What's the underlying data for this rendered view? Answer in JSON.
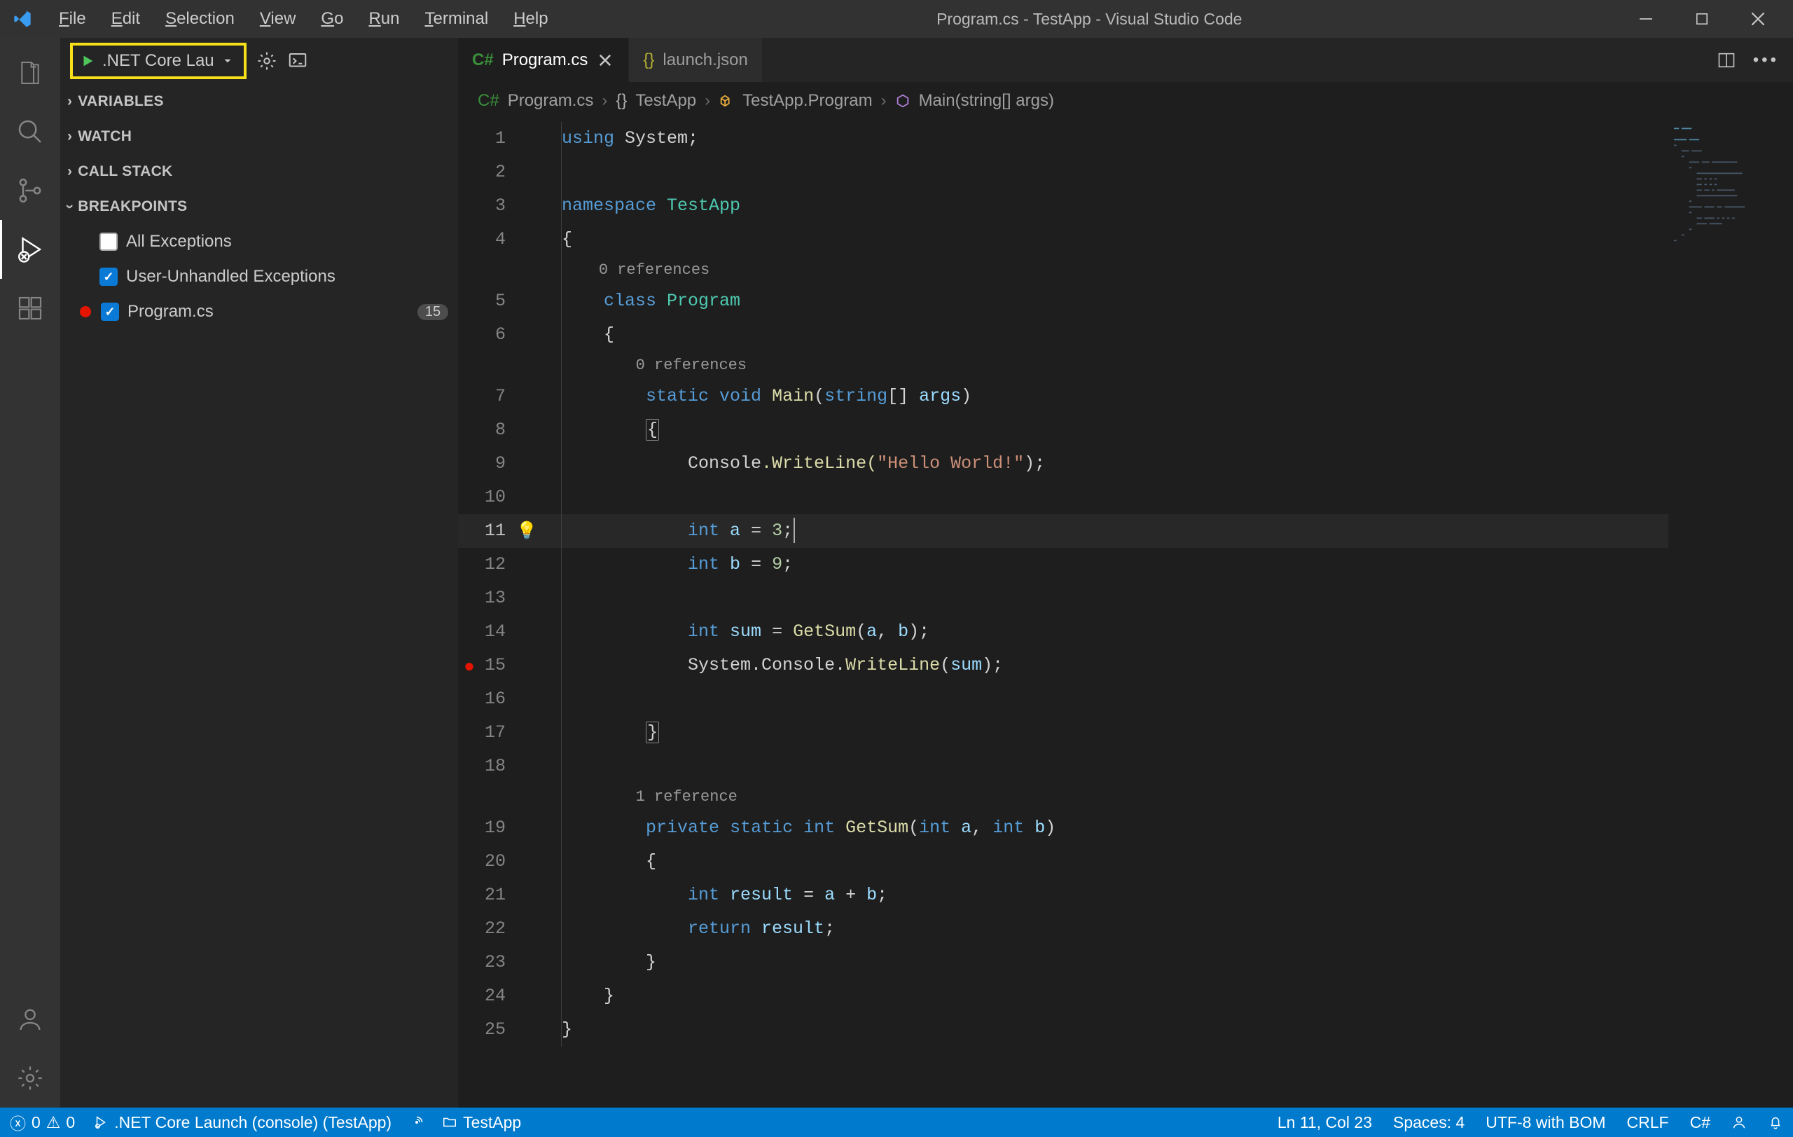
{
  "window": {
    "title": "Program.cs - TestApp - Visual Studio Code"
  },
  "menus": {
    "file": "File",
    "edit": "Edit",
    "selection": "Selection",
    "view": "View",
    "go": "Go",
    "run": "Run",
    "terminal": "Terminal",
    "help": "Help"
  },
  "debug": {
    "launchLabel": ".NET Core Lau",
    "sections": {
      "variables": "VARIABLES",
      "watch": "WATCH",
      "callstack": "CALL STACK",
      "breakpoints": "BREAKPOINTS"
    },
    "breakpoints": {
      "allExceptions": "All Exceptions",
      "userUnhandled": "User-Unhandled Exceptions",
      "file": "Program.cs",
      "fileCount": "15"
    }
  },
  "tabs": {
    "active": "Program.cs",
    "inactive": "launch.json"
  },
  "breadcrumbs": {
    "file": "Program.cs",
    "ns": "TestApp",
    "cls": "TestApp.Program",
    "method": "Main(string[] args)"
  },
  "codelens": {
    "zero": "0 references",
    "one": "1 reference"
  },
  "code": {
    "l1_a": "using",
    "l1_b": " System",
    "l1_c": ";",
    "l3_a": "namespace",
    "l3_b": " TestApp",
    "l4": "{",
    "l5_a": "class",
    "l5_b": " Program",
    "l6": "    {",
    "l7_a": "static",
    "l7_b": " void",
    "l7_c": " Main",
    "l7_d": "(",
    "l7_e": "string",
    "l7_f": "[] ",
    "l7_g": "args",
    "l7_h": ")",
    "l8": "        {",
    "l9_a": "            Console",
    "l9_b": ".WriteLine(",
    "l9_c": "\"Hello World!\"",
    "l9_d": ");",
    "l11_a": "            ",
    "l11_b": "int",
    "l11_c": " a",
    "l11_d": " = ",
    "l11_e": "3",
    "l11_f": ";",
    "l12_a": "            ",
    "l12_b": "int",
    "l12_c": " b",
    "l12_d": " = ",
    "l12_e": "9",
    "l12_f": ";",
    "l14_a": "            ",
    "l14_b": "int",
    "l14_c": " sum",
    "l14_d": " = ",
    "l14_e": "GetSum",
    "l14_f": "(",
    "l14_g": "a",
    "l14_h": ", ",
    "l14_i": "b",
    "l14_j": ");",
    "l15_a": "            System",
    "l15_b": ".Console.",
    "l15_c": "WriteLine",
    "l15_d": "(",
    "l15_e": "sum",
    "l15_f": ");",
    "l17": "        }",
    "l19_a": "private",
    "l19_b": " static",
    "l19_c": " int",
    "l19_d": " GetSum",
    "l19_e": "(",
    "l19_f": "int",
    "l19_g": " a",
    "l19_h": ", ",
    "l19_i": "int",
    "l19_j": " b",
    "l19_k": ")",
    "l20": "        {",
    "l21_a": "            ",
    "l21_b": "int",
    "l21_c": " result",
    "l21_d": " = ",
    "l21_e": "a",
    "l21_f": " + ",
    "l21_g": "b",
    "l21_h": ";",
    "l22_a": "            ",
    "l22_b": "return",
    "l22_c": " result",
    "l22_d": ";",
    "l23": "        }",
    "l24": "    }",
    "l25": "}"
  },
  "lineNums": [
    "1",
    "2",
    "3",
    "4",
    "5",
    "6",
    "7",
    "8",
    "9",
    "10",
    "11",
    "12",
    "13",
    "14",
    "15",
    "16",
    "17",
    "18",
    "19",
    "20",
    "21",
    "22",
    "23",
    "24",
    "25"
  ],
  "status": {
    "errors": "0",
    "warnings": "0",
    "launch": ".NET Core Launch (console) (TestApp)",
    "folder": "TestApp",
    "cursor": "Ln 11, Col 23",
    "spaces": "Spaces: 4",
    "encoding": "UTF-8 with BOM",
    "eol": "CRLF",
    "lang": "C#"
  }
}
